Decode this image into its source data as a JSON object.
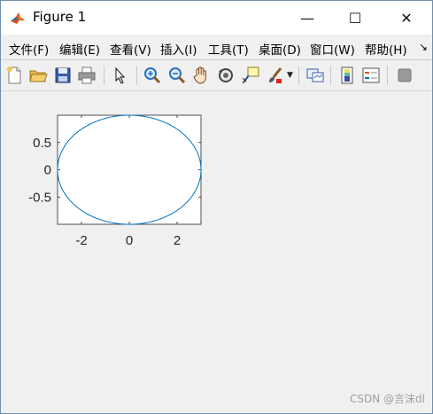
{
  "window": {
    "title": "Figure 1",
    "minimize_glyph": "—",
    "maximize_glyph": "☐",
    "close_glyph": "✕",
    "icon": "matlab-icon"
  },
  "menu": [
    {
      "label": "文件(F)"
    },
    {
      "label": "编辑(E)"
    },
    {
      "label": "查看(V)"
    },
    {
      "label": "插入(I)"
    },
    {
      "label": "工具(T)"
    },
    {
      "label": "桌面(D)"
    },
    {
      "label": "窗口(W)"
    },
    {
      "label": "帮助(H)"
    }
  ],
  "menu_overflow_glyph": "↘",
  "toolbar": [
    "new-figure-icon",
    "open-file-icon",
    "save-icon",
    "print-icon",
    "pointer-icon",
    "zoom-in-icon",
    "zoom-out-icon",
    "pan-icon",
    "rotate-3d-icon",
    "data-cursor-icon",
    "brush-icon",
    "link-plot-icon",
    "colorbar-icon",
    "legend-icon",
    "plot-tools-icon"
  ],
  "chart_data": {
    "type": "line",
    "title": "",
    "xlabel": "",
    "ylabel": "",
    "xlim": [
      -3,
      3
    ],
    "ylim": [
      -1,
      1
    ],
    "xticks": [
      "-2",
      "0",
      "2"
    ],
    "yticks": [
      "-0.5",
      "0",
      "0.5"
    ],
    "line_color": "#0072bd",
    "series": [
      {
        "shape": "ellipse",
        "x_semi_axis": 3,
        "y_semi_axis": 1,
        "center": [
          0,
          0
        ]
      }
    ]
  },
  "watermark": "CSDN @言沫dl"
}
